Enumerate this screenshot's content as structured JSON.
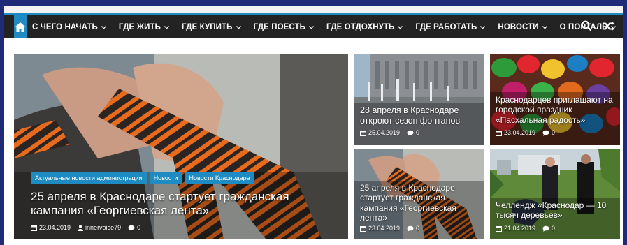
{
  "nav": {
    "items": [
      {
        "label": "С ЧЕГО НАЧАТЬ"
      },
      {
        "label": "ГДЕ ЖИТЬ"
      },
      {
        "label": "ГДЕ КУПИТЬ"
      },
      {
        "label": "ГДЕ ПОЕСТЬ"
      },
      {
        "label": "ГДЕ ОТДОХНУТЬ"
      },
      {
        "label": "ГДЕ РАБОТАТЬ"
      },
      {
        "label": "НОВОСТИ"
      },
      {
        "label": "О ПОРТАЛЕ"
      }
    ],
    "icons": [
      "home-icon",
      "search-icon",
      "shuffle-icon"
    ],
    "accent": "#1e8bc3",
    "bar_color": "#232323"
  },
  "featured": {
    "tags": [
      "Актуальные новости администрации",
      "Новости",
      "Новости Краснодара"
    ],
    "title": "25 апреля в Краснодаре стартует гражданская кампания «Георгиевская лента»",
    "date": "23.04.2019",
    "author": "innervoice79",
    "comments": "0"
  },
  "cards": [
    {
      "title": "28 апреля в Краснодаре откроют сезон фонтанов",
      "date": "25.04.2019",
      "comments": "0"
    },
    {
      "title": "Краснодарцев приглашают на городской праздник «Пасхальная радость»",
      "date": "23.04.2019",
      "comments": "0"
    },
    {
      "title": "25 апреля в Краснодаре стартует гражданская кампания «Георгиевская лента»",
      "date": "23.04.2019",
      "comments": "0"
    },
    {
      "title": "Челлендж «Краснодар — 10 тысяч деревьев»",
      "date": "21.04.2019",
      "comments": "0"
    }
  ]
}
